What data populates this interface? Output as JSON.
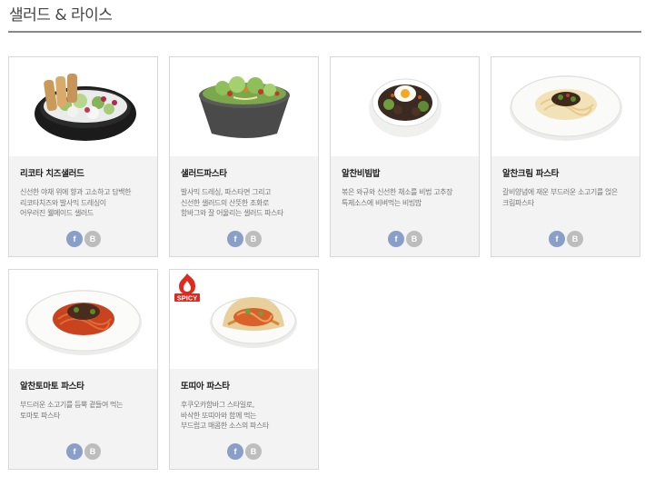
{
  "section": {
    "title": "샐러드 & 라이스"
  },
  "share": {
    "facebook_icon": "f",
    "blog_icon": "B"
  },
  "badges": {
    "spicy": "SPICY"
  },
  "colors": {
    "facebook": "#8a9fc8",
    "blog": "#bdbdbd",
    "spicy": "#e02a1f"
  },
  "menu_items": [
    {
      "name": "리코타 치즈샐러드",
      "desc_lines": [
        "신선한 야채 위에 향과 고소하고 담백한",
        "리코타치즈와 발사믹 드레싱이",
        "어우러진 웰메이드 샐러드"
      ],
      "image_icon": "salad-bowl-icon"
    },
    {
      "name": "샐러드파스타",
      "desc_lines": [
        "발사믹 드레싱, 파스타면 그리고",
        "신선한 샐러드의 산뜻한 조화로",
        "함바그와 잘 어울리는 샐러드 파스타"
      ],
      "image_icon": "salad-pasta-icon"
    },
    {
      "name": "알찬비빔밥",
      "desc_lines": [
        "볶은 와규와 신선한 채소를 비법 고추장",
        "특제소스에 비벼먹는 비빔밥"
      ],
      "image_icon": "bibimbap-icon"
    },
    {
      "name": "알찬크림 파스타",
      "desc_lines": [
        "갈비양념에 재운 부드러운 소고기를 얹은",
        "크림파스타"
      ],
      "image_icon": "cream-pasta-icon"
    },
    {
      "name": "알찬토마토 파스타",
      "desc_lines": [
        "부드러운 소고기를 듬뿍 곁들여 먹는",
        "토마토 파스타"
      ],
      "image_icon": "tomato-pasta-icon"
    },
    {
      "name": "또띠아 파스타",
      "desc_lines": [
        "후쿠오카함바그 스타일로,",
        "바삭한 또띠아와 함께 먹는",
        "부드럽고 매콤한 소스의 파스타"
      ],
      "image_icon": "tortilla-pasta-icon"
    }
  ]
}
